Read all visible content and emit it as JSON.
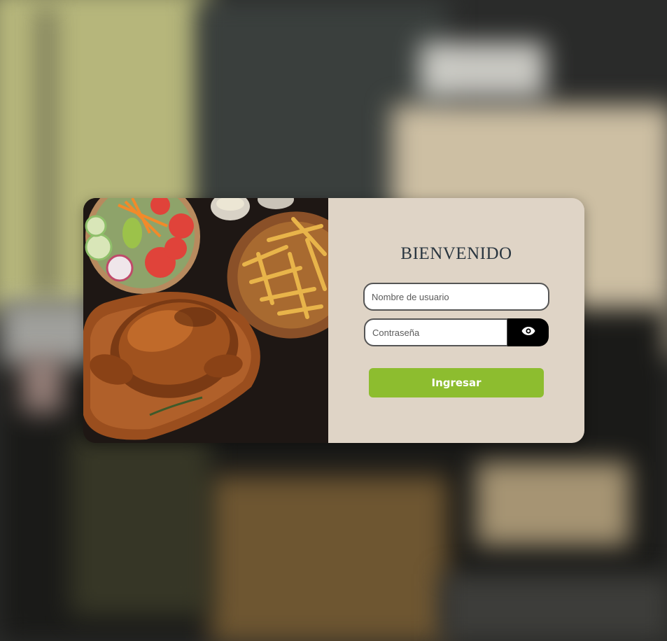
{
  "login": {
    "title": "BIENVENIDO",
    "username_placeholder": "Nombre de usuario",
    "password_placeholder": "Contraseña",
    "submit_label": "Ingresar",
    "show_password_icon": "eye-icon"
  },
  "colors": {
    "panel_background": "#dfd4c6",
    "button_accent": "#8dbd2f",
    "eye_button": "#000000",
    "title_text": "#2a3640"
  }
}
